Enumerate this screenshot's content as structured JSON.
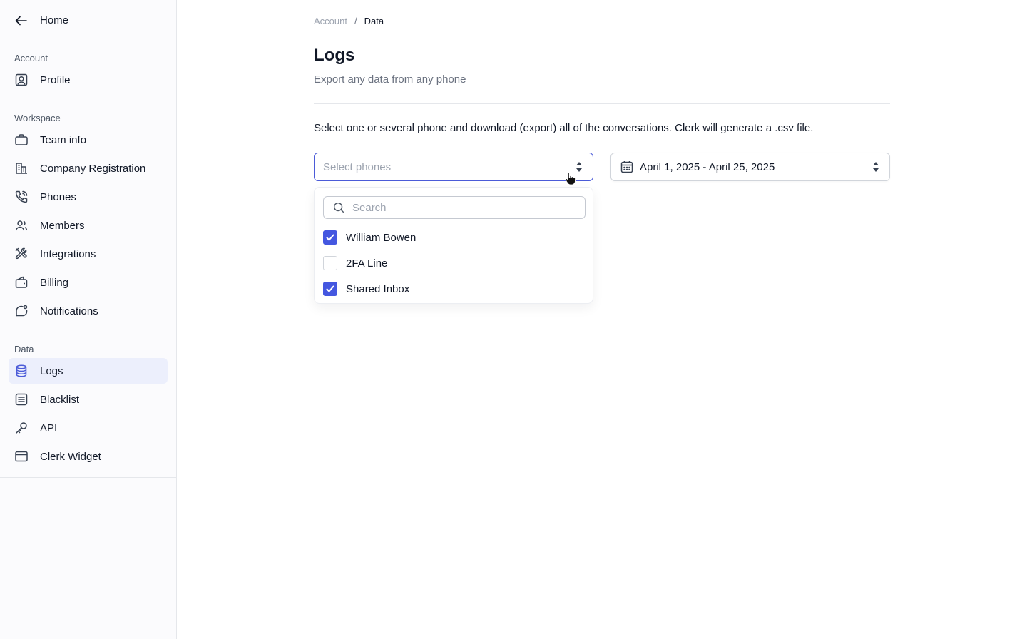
{
  "sidebar": {
    "home_label": "Home",
    "sections": [
      {
        "title": "Account",
        "items": [
          {
            "label": "Profile",
            "icon": "profile-icon"
          }
        ]
      },
      {
        "title": "Workspace",
        "items": [
          {
            "label": "Team info",
            "icon": "briefcase-icon"
          },
          {
            "label": "Company Registration",
            "icon": "building-icon"
          },
          {
            "label": "Phones",
            "icon": "phone-icon"
          },
          {
            "label": "Members",
            "icon": "members-icon"
          },
          {
            "label": "Integrations",
            "icon": "tools-icon"
          },
          {
            "label": "Billing",
            "icon": "wallet-icon"
          },
          {
            "label": "Notifications",
            "icon": "bell-icon"
          }
        ]
      },
      {
        "title": "Data",
        "items": [
          {
            "label": "Logs",
            "icon": "database-icon",
            "active": true
          },
          {
            "label": "Blacklist",
            "icon": "list-icon"
          },
          {
            "label": "API",
            "icon": "key-icon"
          },
          {
            "label": "Clerk Widget",
            "icon": "window-icon"
          }
        ]
      }
    ]
  },
  "breadcrumb": {
    "root": "Account",
    "separator": "/",
    "current": "Data"
  },
  "page": {
    "title": "Logs",
    "subtitle": "Export any data from any phone",
    "description": "Select one or several phone and download (export) all of the conversations. Clerk will generate a .csv file."
  },
  "phone_select": {
    "placeholder": "Select phones",
    "search_placeholder": "Search",
    "options": [
      {
        "label": "William Bowen",
        "checked": true
      },
      {
        "label": "2FA Line",
        "checked": false
      },
      {
        "label": "Shared Inbox",
        "checked": true
      }
    ]
  },
  "date_range": {
    "value": "April 1, 2025 - April 25, 2025"
  },
  "colors": {
    "accent": "#4457e0",
    "active_bg": "#eceffc"
  }
}
